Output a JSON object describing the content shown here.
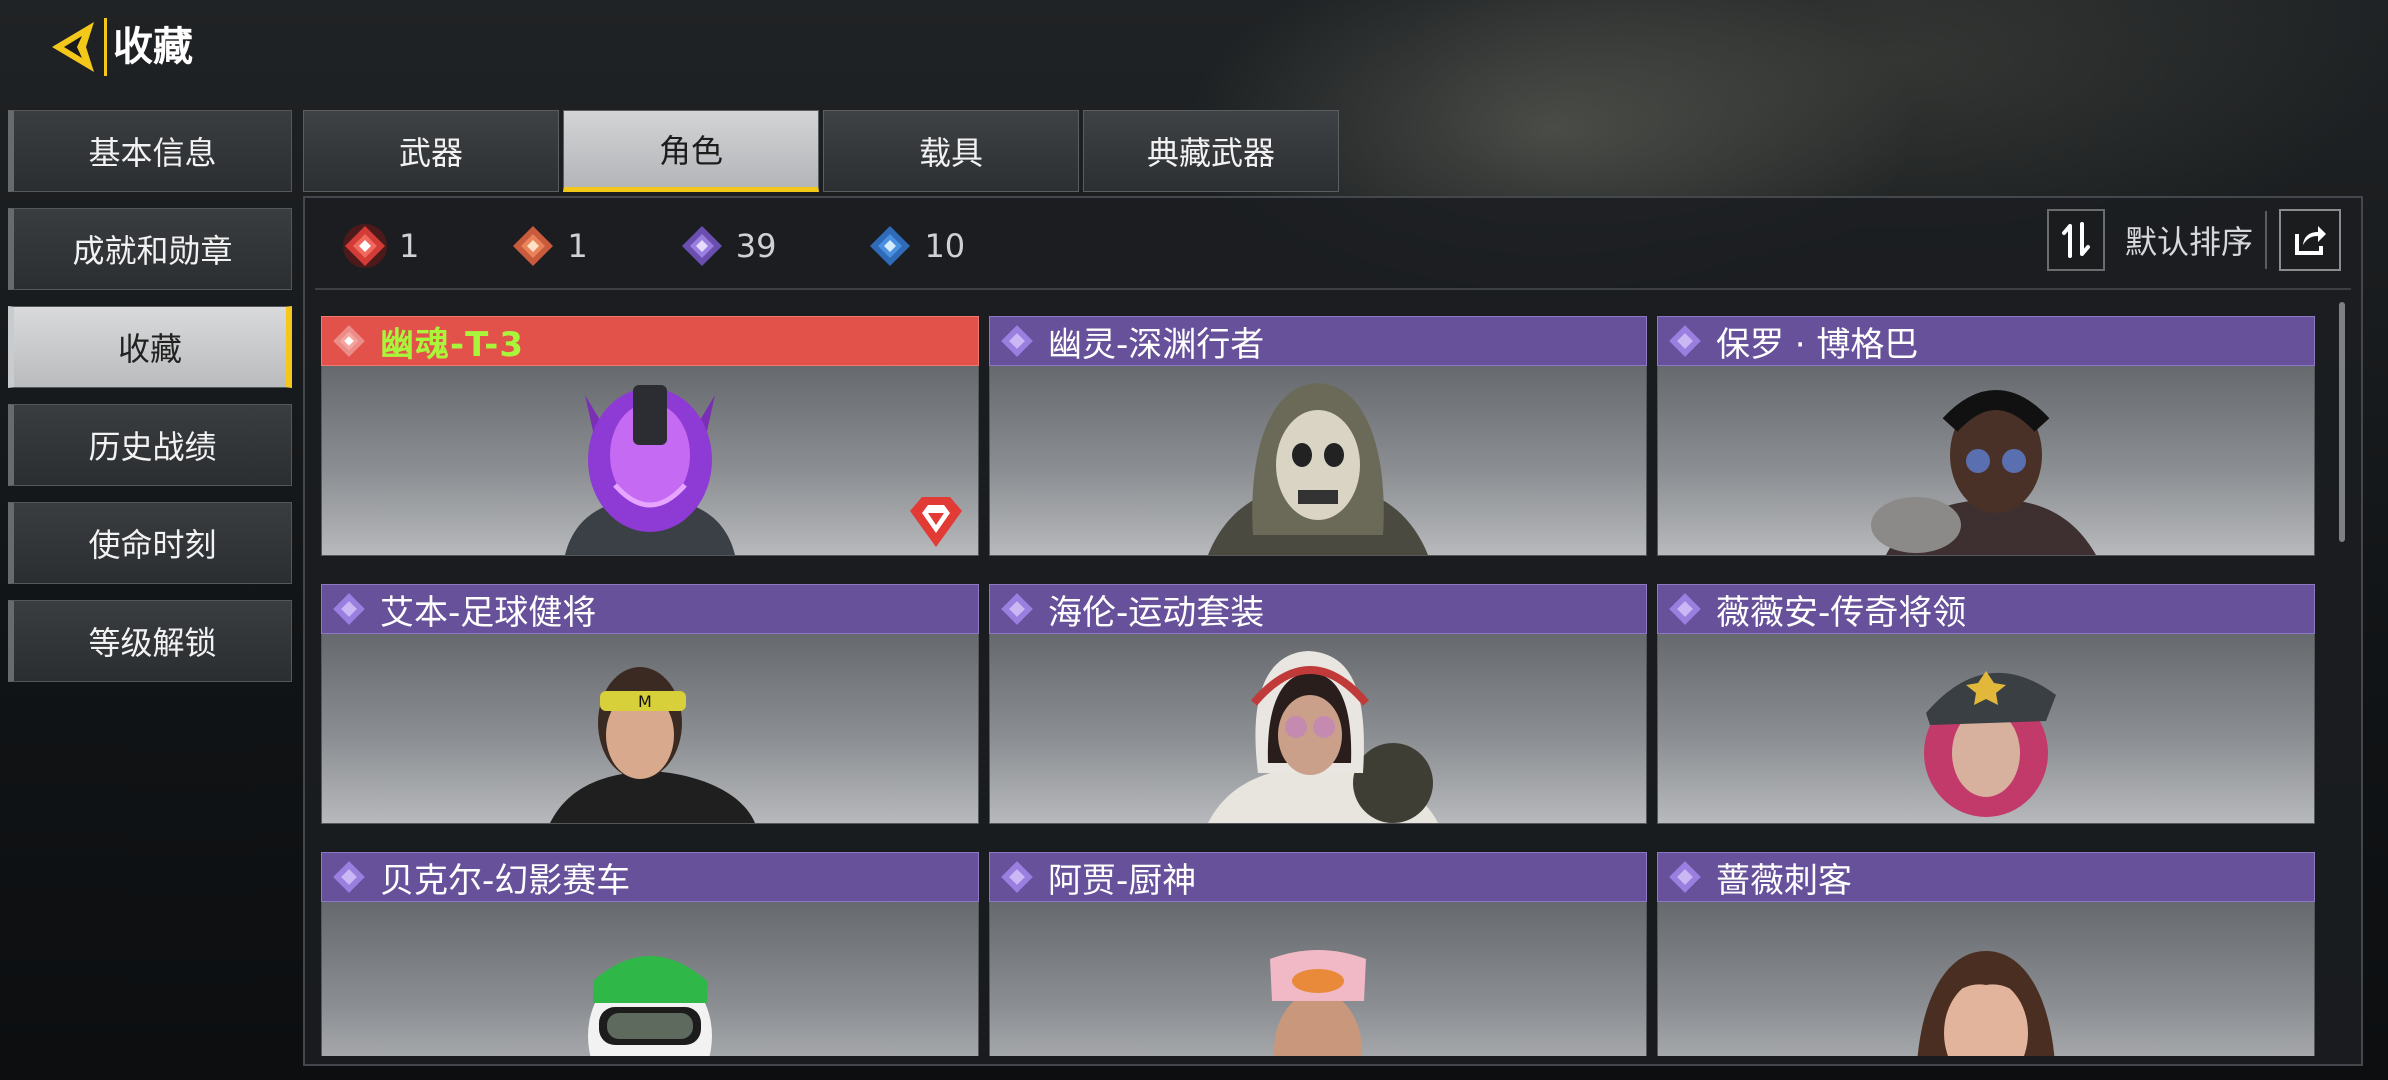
{
  "header": {
    "title": "收藏"
  },
  "left_menu": [
    {
      "label": "基本信息",
      "active": false
    },
    {
      "label": "成就和勋章",
      "active": false
    },
    {
      "label": "收藏",
      "active": true
    },
    {
      "label": "历史战绩",
      "active": false
    },
    {
      "label": "使命时刻",
      "active": false
    },
    {
      "label": "等级解锁",
      "active": false
    }
  ],
  "tabs": [
    {
      "label": "武器",
      "active": false
    },
    {
      "label": "角色",
      "active": true
    },
    {
      "label": "载具",
      "active": false
    },
    {
      "label": "典藏武器",
      "active": false
    }
  ],
  "rarity_counts": [
    {
      "icon": "mythic-red-icon",
      "count": "1"
    },
    {
      "icon": "legendary-orange-icon",
      "count": "1"
    },
    {
      "icon": "epic-purple-icon",
      "count": "39"
    },
    {
      "icon": "rare-blue-icon",
      "count": "10"
    }
  ],
  "sort": {
    "label": "默认排序"
  },
  "cards": [
    {
      "name": "幽魂-T-3",
      "rarity": "mythic"
    },
    {
      "name": "幽灵-深渊行者",
      "rarity": "epic"
    },
    {
      "name": "保罗 · 博格巴",
      "rarity": "epic"
    },
    {
      "name": "艾本-足球健将",
      "rarity": "epic"
    },
    {
      "name": "海伦-运动套装",
      "rarity": "epic"
    },
    {
      "name": "薇薇安-传奇将领",
      "rarity": "epic"
    },
    {
      "name": "贝克尔-幻影赛车",
      "rarity": "epic"
    },
    {
      "name": "阿贾-厨神",
      "rarity": "epic"
    },
    {
      "name": "蔷薇刺客",
      "rarity": "epic"
    }
  ],
  "colors": {
    "accent": "#f3c81b",
    "epic": "#67519a",
    "mythic": "#e2514a",
    "mythic_title": "#a9f53b",
    "rare": "#4a8fe0",
    "legendary": "#e8835a"
  }
}
